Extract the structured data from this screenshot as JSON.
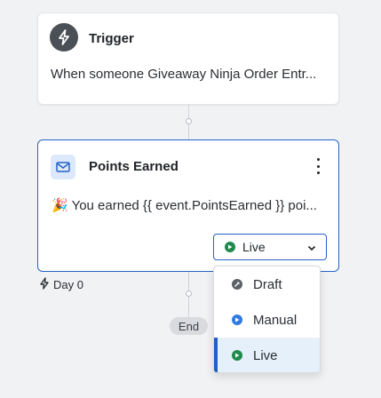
{
  "trigger": {
    "title": "Trigger",
    "description": "When someone Giveaway Ninja Order Entr...",
    "icon": "lightning-icon"
  },
  "email_step": {
    "title": "Points Earned",
    "description": "🎉 You earned {{ event.PointsEarned }} poi...",
    "icon": "envelope-icon",
    "status": "Live"
  },
  "delay": {
    "label": "Day 0",
    "icon": "lightning-icon"
  },
  "end_label": "End",
  "status_options": [
    {
      "label": "Draft",
      "icon": "draft-status-icon"
    },
    {
      "label": "Manual",
      "icon": "manual-status-icon"
    },
    {
      "label": "Live",
      "icon": "live-status-icon",
      "selected": true
    }
  ],
  "colors": {
    "accent": "#2563c9",
    "live": "#1e8a4c",
    "manual": "#2f7be0",
    "draft": "#5c6168",
    "selected_bg": "#e6f0fb"
  }
}
